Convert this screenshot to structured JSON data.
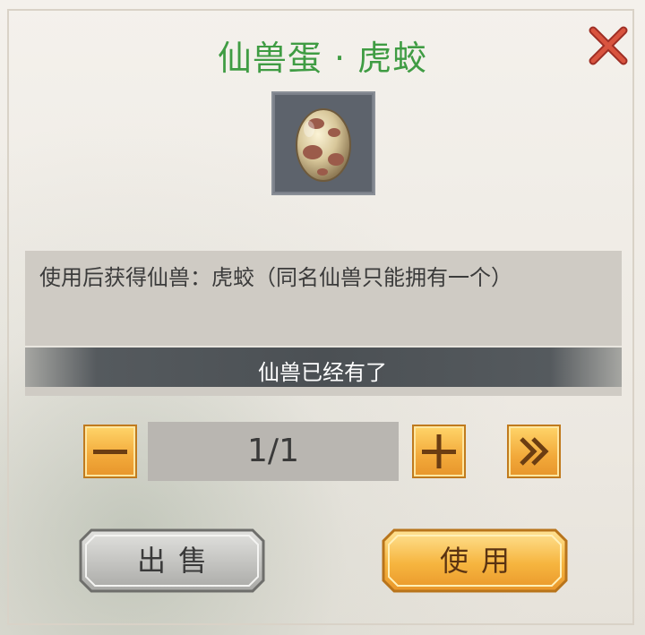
{
  "dialog": {
    "title": "仙兽蛋 · 虎蛟",
    "description": "使用后获得仙兽：虎蛟（同名仙兽只能拥有一个）",
    "status": "仙兽已经有了"
  },
  "quantity": {
    "value": "1/1"
  },
  "buttons": {
    "sell_label": "出售",
    "use_label": "使用"
  },
  "item": {
    "icon": "spotted-egg-icon"
  },
  "colors": {
    "title": "#3f9c43",
    "accent_orange": "#f2a93a",
    "close_red": "#d04a3a"
  }
}
